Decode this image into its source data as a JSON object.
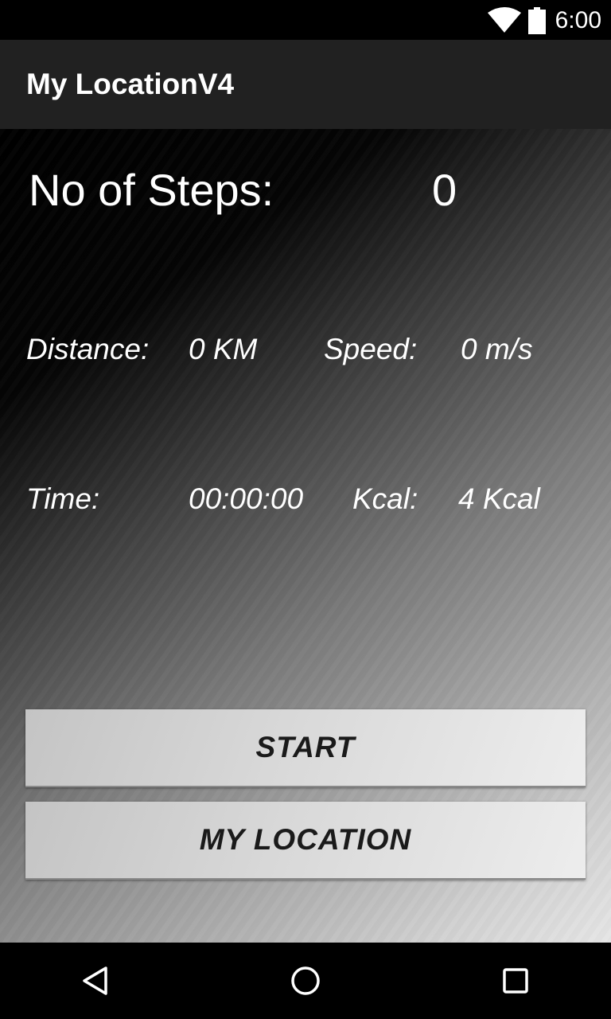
{
  "status_bar": {
    "time": "6:00",
    "wifi_icon": "wifi-icon",
    "battery_icon": "battery-icon"
  },
  "app_bar": {
    "title": "My LocationV4"
  },
  "steps": {
    "label": "No of Steps:",
    "value": "0"
  },
  "metrics": {
    "distance_label": "Distance:",
    "distance_value": "0 KM",
    "speed_label": "Speed:",
    "speed_value": "0 m/s",
    "time_label": "Time:",
    "time_value": "00:00:00",
    "kcal_label": "Kcal:",
    "kcal_value": "4 Kcal"
  },
  "buttons": {
    "start_label": "START",
    "my_location_label": "MY LOCATION"
  },
  "nav_bar": {
    "back_icon": "back-icon",
    "home_icon": "home-icon",
    "recents_icon": "recents-icon"
  },
  "colors": {
    "app_bar": "#212121",
    "status_bar": "#000000",
    "button": "#d8d8d8",
    "text_light": "#ffffff",
    "text_dark": "#1a1a1a"
  }
}
